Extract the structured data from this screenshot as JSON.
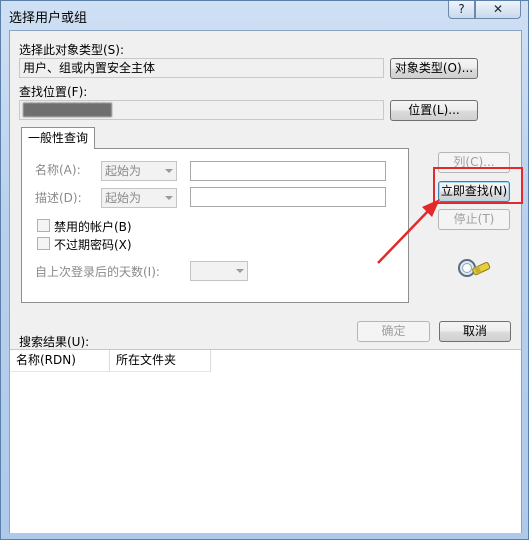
{
  "window": {
    "title": "选择用户或组",
    "help_symbol": "?",
    "close_symbol": "✕"
  },
  "object_type": {
    "label": "选择此对象类型(S):",
    "value": "用户、组或内置安全主体",
    "button": "对象类型(O)..."
  },
  "location": {
    "label": "查找位置(F):",
    "value": "████████████",
    "button": "位置(L)..."
  },
  "tab": {
    "label": "一般性查询"
  },
  "query": {
    "name_label": "名称(A):",
    "name_mode": "起始为",
    "desc_label": "描述(D):",
    "desc_mode": "起始为",
    "disabled_accounts": "禁用的帐户(B)",
    "no_expire_password": "不过期密码(X)",
    "days_label": "自上次登录后的天数(I):"
  },
  "buttons": {
    "columns": "列(C)...",
    "find_now": "立即查找(N)",
    "stop": "停止(T)",
    "ok": "确定",
    "cancel": "取消"
  },
  "results": {
    "label": "搜索结果(U):",
    "columns": [
      "名称(RDN)",
      "所在文件夹"
    ]
  },
  "icons": {
    "search_flashlight": "flashlight-search-icon"
  },
  "colors": {
    "annotation": "#e32a2a",
    "window_frame": "#b9d1ee",
    "dialog_bg": "#f0f0f0"
  }
}
